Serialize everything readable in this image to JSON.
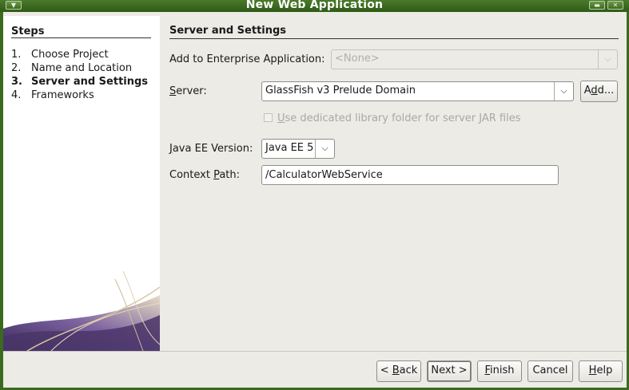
{
  "window": {
    "title": "New Web Application",
    "menu_icon": "chevron-down-icon",
    "minimize_icon": "minimize-icon",
    "close_icon": "close-icon"
  },
  "steps": {
    "title": "Steps",
    "items": [
      {
        "num": "1.",
        "label": "Choose Project"
      },
      {
        "num": "2.",
        "label": "Name and Location"
      },
      {
        "num": "3.",
        "label": "Server and Settings"
      },
      {
        "num": "4.",
        "label": "Frameworks"
      }
    ]
  },
  "main": {
    "section_title": "Server and Settings",
    "enterprise_label": "Add to Enterprise Application:",
    "enterprise_value": "<None>",
    "server_label_pre": "",
    "server_label_mnemonic": "S",
    "server_label_post": "erver:",
    "server_value": "GlassFish v3 Prelude Domain",
    "add_button_pre": "A",
    "add_button_mnemonic": "d",
    "add_button_post": "d...",
    "dedicated_label_mnemonic": "U",
    "dedicated_label_post": "se dedicated library folder for server JAR files",
    "javaee_label_pre": "",
    "javaee_label_mnemonic": "J",
    "javaee_label_post": "ava EE Version:",
    "javaee_value": "Java EE 5",
    "context_label_pre": "Context ",
    "context_label_mnemonic": "P",
    "context_label_post": "ath:",
    "context_value": "/CalculatorWebService"
  },
  "footer": {
    "back_pre": "< ",
    "back_mnemonic": "B",
    "back_post": "ack",
    "next_label": "Next >",
    "finish_mnemonic": "F",
    "finish_post": "inish",
    "cancel_label": "Cancel",
    "help_mnemonic": "H",
    "help_post": "elp"
  },
  "colors": {
    "titlebar": "#3b6a1d",
    "dialog_bg": "#ecebe6",
    "steps_bg": "#ffffff",
    "swoosh_purple": "#6b4f8c",
    "swoosh_gold": "#d8c79a"
  }
}
